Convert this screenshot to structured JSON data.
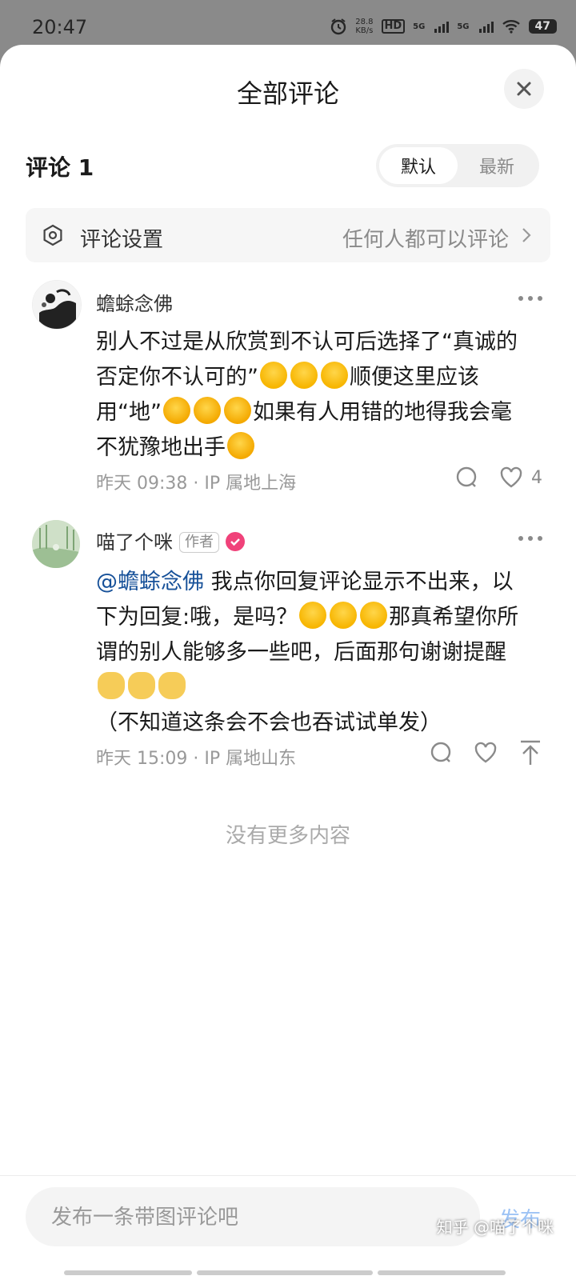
{
  "status_bar": {
    "time": "20:47",
    "net_speed_value": "28.8",
    "net_speed_unit": "KB/s",
    "hd_label": "HD",
    "network_1": "5G",
    "network_2": "5G",
    "battery": "47"
  },
  "sheet": {
    "title": "全部评论",
    "comment_count_label": "评论 1",
    "sort_options": [
      "默认",
      "最新"
    ],
    "active_sort": "默认",
    "settings": {
      "label": "评论设置",
      "value": "任何人都可以评论"
    }
  },
  "comments": [
    {
      "author": "蟾蜍念佛",
      "text_parts": [
        "别人不过是从欣赏到不认可后选择了“真诚的否定你不认可的”",
        "顺便这里应该用“地”",
        "如果有人用错的地得我会毫不犹豫地出手"
      ],
      "time": "昨天 09:38",
      "location": "IP 属地上海",
      "likes": "4"
    },
    {
      "author": "喵了个咪",
      "author_tag": "作者",
      "mention": "@蟾蜍念佛",
      "text_parts": [
        " 我点你回复评论显示不出来，以下为回复:哦，是吗？",
        "那真希望你所谓的别人能够多一些吧，后面那句谢谢提醒",
        "（不知道这条会不会也吞试试单发）"
      ],
      "time": "昨天 15:09",
      "location": "IP 属地山东"
    }
  ],
  "no_more_text": "没有更多内容",
  "input": {
    "placeholder": "发布一条带图评论吧",
    "publish_label": "发布"
  },
  "watermark": "知乎 @喵了个咪",
  "colors": {
    "mention": "#175199",
    "publish_disabled": "#9dc3f5",
    "badge": "#f0427a"
  }
}
